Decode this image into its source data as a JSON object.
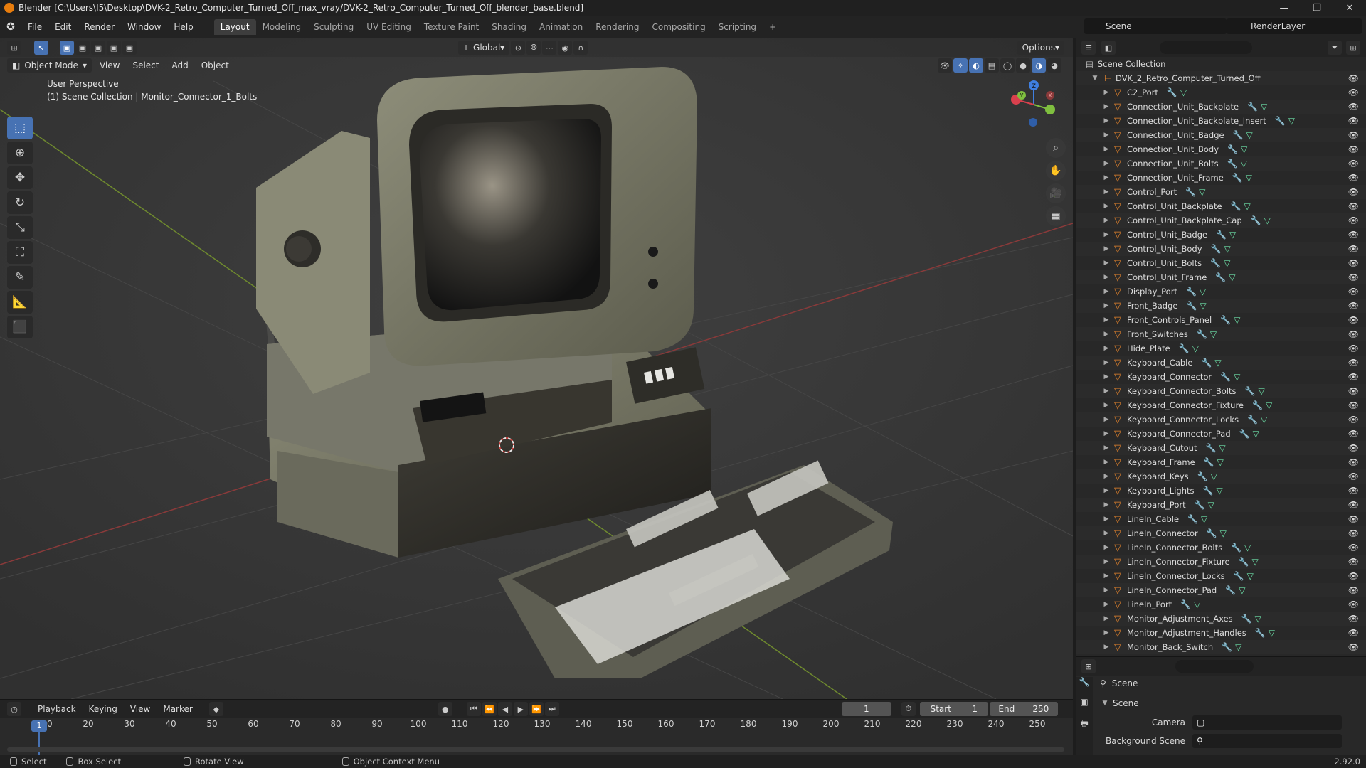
{
  "window": {
    "title": "Blender [C:\\Users\\I5\\Desktop\\DVK-2_Retro_Computer_Turned_Off_max_vray/DVK-2_Retro_Computer_Turned_Off_blender_base.blend]",
    "controls": [
      "—",
      "❐",
      "✕"
    ]
  },
  "menu": [
    "File",
    "Edit",
    "Render",
    "Window",
    "Help"
  ],
  "workspaces": [
    "Layout",
    "Modeling",
    "Sculpting",
    "UV Editing",
    "Texture Paint",
    "Shading",
    "Animation",
    "Rendering",
    "Compositing",
    "Scripting",
    "+"
  ],
  "scene": {
    "name": "Scene",
    "view_layer": "RenderLayer"
  },
  "viewport": {
    "transform_orientation": "Global",
    "options_label": "Options",
    "mode": "Object Mode",
    "menus": [
      "View",
      "Select",
      "Add",
      "Object"
    ],
    "overlay_line1": "User Perspective",
    "overlay_line2": "(1) Scene Collection | Monitor_Connector_1_Bolts",
    "axes": {
      "x": "X",
      "y": "Y",
      "z": "Z"
    }
  },
  "toolbar_icons": [
    "select-box-icon",
    "cursor-icon",
    "move-icon",
    "rotate-icon",
    "scale-icon",
    "transform-icon",
    "annotate-icon",
    "measure-icon",
    "add-cube-icon"
  ],
  "outliner": {
    "root": "Scene Collection",
    "collection": "DVK_2_Retro_Computer_Turned_Off",
    "items": [
      "C2_Port",
      "Connection_Unit_Backplate",
      "Connection_Unit_Backplate_Insert",
      "Connection_Unit_Badge",
      "Connection_Unit_Body",
      "Connection_Unit_Bolts",
      "Connection_Unit_Frame",
      "Control_Port",
      "Control_Unit_Backplate",
      "Control_Unit_Backplate_Cap",
      "Control_Unit_Badge",
      "Control_Unit_Body",
      "Control_Unit_Bolts",
      "Control_Unit_Frame",
      "Display_Port",
      "Front_Badge",
      "Front_Controls_Panel",
      "Front_Switches",
      "Hide_Plate",
      "Keyboard_Cable",
      "Keyboard_Connector",
      "Keyboard_Connector_Bolts",
      "Keyboard_Connector_Fixture",
      "Keyboard_Connector_Locks",
      "Keyboard_Connector_Pad",
      "Keyboard_Cutout",
      "Keyboard_Frame",
      "Keyboard_Keys",
      "Keyboard_Lights",
      "Keyboard_Port",
      "LineIn_Cable",
      "LineIn_Connector",
      "LineIn_Connector_Bolts",
      "LineIn_Connector_Fixture",
      "LineIn_Connector_Locks",
      "LineIn_Connector_Pad",
      "LineIn_Port",
      "Monitor_Adjustment_Axes",
      "Monitor_Adjustment_Handles",
      "Monitor_Back_Switch"
    ]
  },
  "properties": {
    "breadcrumb": "Scene",
    "panel": "Scene",
    "camera_label": "Camera",
    "background_label": "Background Scene"
  },
  "timeline": {
    "menus": [
      "Playback",
      "Keying",
      "View",
      "Marker"
    ],
    "current_frame": "1",
    "start_label": "Start",
    "start": "1",
    "end_label": "End",
    "end": "250",
    "ticks": [
      "10",
      "20",
      "30",
      "40",
      "50",
      "60",
      "70",
      "80",
      "90",
      "100",
      "110",
      "120",
      "130",
      "140",
      "150",
      "160",
      "170",
      "180",
      "190",
      "200",
      "210",
      "220",
      "230",
      "240",
      "250"
    ]
  },
  "status": {
    "select": "Select",
    "box_select": "Box Select",
    "rotate": "Rotate View",
    "context": "Object Context Menu",
    "version": "2.92.0"
  },
  "colors": {
    "accent": "#4772b3",
    "mesh": "#e8862d",
    "x_axis": "#d9404d",
    "y_axis": "#7fbf3f",
    "z_axis": "#3f7fe0"
  }
}
